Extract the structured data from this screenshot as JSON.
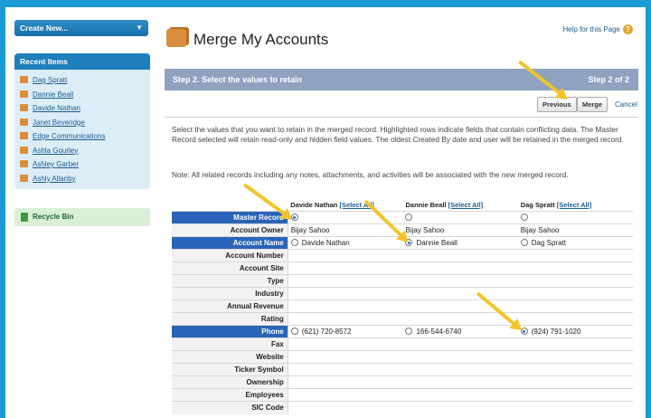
{
  "sidebar": {
    "create_new_label": "Create New...",
    "recent_header": "Recent Items",
    "recent_items": [
      {
        "label": "Dag Spratt"
      },
      {
        "label": "Dannie Beall"
      },
      {
        "label": "Davide Nathan"
      },
      {
        "label": "Janet Beveridge"
      },
      {
        "label": "Edge Communications"
      },
      {
        "label": "Ashla Gourley"
      },
      {
        "label": "Ashley Garber"
      },
      {
        "label": "Ashly Allanby"
      }
    ],
    "recycle_label": "Recycle Bin"
  },
  "header": {
    "title": "Merge My Accounts",
    "help_label": "Help for this Page",
    "help_icon": "?"
  },
  "step": {
    "title": "Step 2. Select the values to retain",
    "counter": "Step 2 of 2"
  },
  "buttons": {
    "previous": "Previous",
    "merge": "Merge",
    "cancel": "Cancel"
  },
  "description": "Select the values that you want to retain in the merged record. Highlighted rows indicate fields that contain conflicting data. The Master Record selected will retain read-only and hidden field values. The oldest Created By date and user will be retained in the merged record.",
  "note": "Note: All related records including any notes, attachments, and activities will be associated with the new merged record.",
  "table": {
    "columns": [
      {
        "name": "Davide Nathan",
        "select_all": "[Select All]"
      },
      {
        "name": "Dannie Beall",
        "select_all": "[Select All]"
      },
      {
        "name": "Dag Spratt",
        "select_all": "[Select All]"
      }
    ],
    "rows": [
      {
        "label": "Master Record",
        "highlight": true,
        "cells": [
          {
            "radio": true,
            "checked": true,
            "text": ""
          },
          {
            "radio": true,
            "checked": false,
            "text": ""
          },
          {
            "radio": true,
            "checked": false,
            "text": ""
          }
        ]
      },
      {
        "label": "Account Owner",
        "highlight": false,
        "cells": [
          {
            "text": "Bijay Sahoo"
          },
          {
            "text": "Bijay Sahoo"
          },
          {
            "text": "Bijay Sahoo"
          }
        ]
      },
      {
        "label": "Account Name",
        "highlight": true,
        "cells": [
          {
            "radio": true,
            "checked": false,
            "text": "Davide Nathan"
          },
          {
            "radio": true,
            "checked": true,
            "text": "Dannie Beall"
          },
          {
            "radio": true,
            "checked": false,
            "text": "Dag Spratt"
          }
        ]
      },
      {
        "label": "Account Number",
        "highlight": false,
        "cells": [
          {
            "text": ""
          },
          {
            "text": ""
          },
          {
            "text": ""
          }
        ]
      },
      {
        "label": "Account Site",
        "highlight": false,
        "cells": [
          {
            "text": ""
          },
          {
            "text": ""
          },
          {
            "text": ""
          }
        ]
      },
      {
        "label": "Type",
        "highlight": false,
        "cells": [
          {
            "text": ""
          },
          {
            "text": ""
          },
          {
            "text": ""
          }
        ]
      },
      {
        "label": "Industry",
        "highlight": false,
        "cells": [
          {
            "text": ""
          },
          {
            "text": ""
          },
          {
            "text": ""
          }
        ]
      },
      {
        "label": "Annual Revenue",
        "highlight": false,
        "cells": [
          {
            "text": ""
          },
          {
            "text": ""
          },
          {
            "text": ""
          }
        ]
      },
      {
        "label": "Rating",
        "highlight": false,
        "cells": [
          {
            "text": ""
          },
          {
            "text": ""
          },
          {
            "text": ""
          }
        ]
      },
      {
        "label": "Phone",
        "highlight": true,
        "cells": [
          {
            "radio": true,
            "checked": false,
            "text": "(621) 720-8572"
          },
          {
            "radio": true,
            "checked": false,
            "text": "166-544-6740"
          },
          {
            "radio": true,
            "checked": true,
            "text": "(924) 791-1020"
          }
        ]
      },
      {
        "label": "Fax",
        "highlight": false,
        "cells": [
          {
            "text": ""
          },
          {
            "text": ""
          },
          {
            "text": ""
          }
        ]
      },
      {
        "label": "Website",
        "highlight": false,
        "cells": [
          {
            "text": ""
          },
          {
            "text": ""
          },
          {
            "text": ""
          }
        ]
      },
      {
        "label": "Ticker Symbol",
        "highlight": false,
        "cells": [
          {
            "text": ""
          },
          {
            "text": ""
          },
          {
            "text": ""
          }
        ]
      },
      {
        "label": "Ownership",
        "highlight": false,
        "cells": [
          {
            "text": ""
          },
          {
            "text": ""
          },
          {
            "text": ""
          }
        ]
      },
      {
        "label": "Employees",
        "highlight": false,
        "cells": [
          {
            "text": ""
          },
          {
            "text": ""
          },
          {
            "text": ""
          }
        ]
      },
      {
        "label": "SIC Code",
        "highlight": false,
        "cells": [
          {
            "text": ""
          },
          {
            "text": ""
          },
          {
            "text": ""
          }
        ]
      }
    ]
  },
  "colors": {
    "page_border": "#1b9ad4",
    "highlight_row": "#2a64b8",
    "step_bar": "#8fa2bf",
    "arrow": "#f2c42b"
  }
}
